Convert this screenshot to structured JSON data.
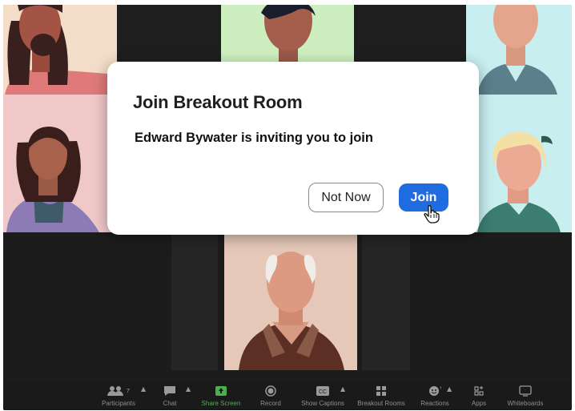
{
  "dialog": {
    "title": "Join Breakout Room",
    "message": "Edward Bywater is inviting you to join",
    "not_now_label": "Not Now",
    "join_label": "Join"
  },
  "toolbar": {
    "participants_label": "Participants",
    "participants_count": "7",
    "chat_label": "Chat",
    "share_screen_label": "Share Screen",
    "record_label": "Record",
    "show_captions_label": "Show Captions",
    "breakout_rooms_label": "Breakout Rooms",
    "reactions_label": "Reactions",
    "apps_label": "Apps",
    "whiteboards_label": "Whiteboards"
  },
  "colors": {
    "join_button": "#1f6ce0",
    "share_screen": "#4caf50",
    "toolbar_background": "#1a1a1a"
  },
  "icons": {
    "participants": "participants-icon",
    "chat": "chat-icon",
    "share_screen": "share-screen-icon",
    "record": "record-icon",
    "show_captions": "captions-icon",
    "breakout_rooms": "breakout-rooms-icon",
    "reactions": "reactions-icon",
    "apps": "apps-icon",
    "whiteboards": "whiteboards-icon",
    "cursor": "hand-pointer-icon"
  }
}
